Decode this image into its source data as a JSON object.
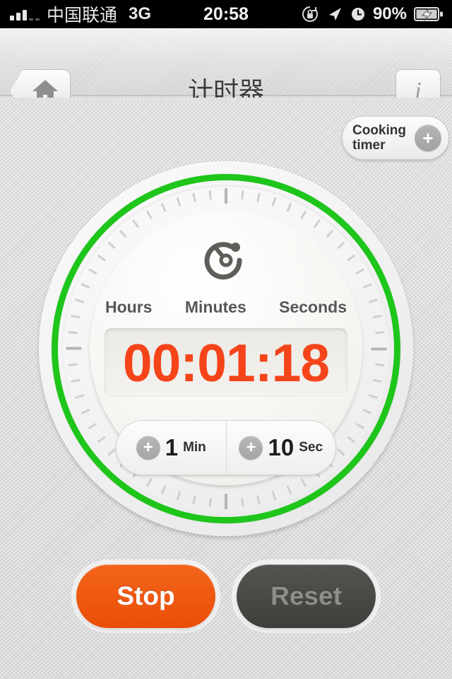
{
  "status_bar": {
    "carrier": "中国联通",
    "network": "3G",
    "time": "20:58",
    "battery_percent": "90%",
    "icons": [
      "signal-bars-icon",
      "rotation-lock-icon",
      "location-arrow-icon",
      "alarm-clock-icon",
      "battery-charging-icon"
    ]
  },
  "nav_bar": {
    "title": "计时器",
    "home_icon": "home-icon",
    "info_label": "i"
  },
  "cooking_timer": {
    "label_line1": "Cooking",
    "label_line2": "timer",
    "add_label": "+"
  },
  "dial": {
    "icon": "stopwatch-icon",
    "unit_hours": "Hours",
    "unit_minutes": "Minutes",
    "unit_seconds": "Seconds",
    "display": "00:01:18",
    "add_minute": {
      "plus": "+",
      "amount": "1",
      "unit": "Min"
    },
    "add_second": {
      "plus": "+",
      "amount": "10",
      "unit": "Sec"
    },
    "progress_color": "#1ec51a",
    "digits_color": "#f5441a"
  },
  "actions": {
    "stop_label": "Stop",
    "reset_label": "Reset",
    "stop_color": "#ea4e07",
    "reset_color": "#3e3e3b"
  }
}
